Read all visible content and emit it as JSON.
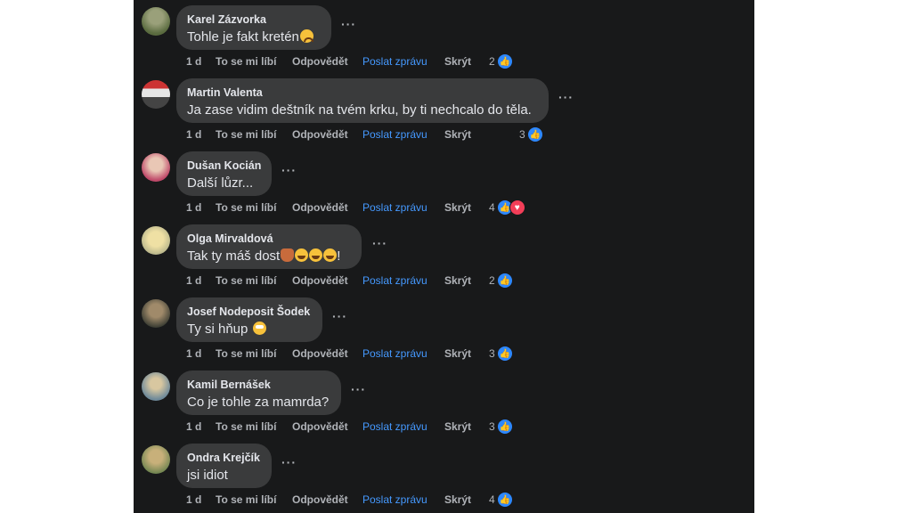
{
  "comments": [
    {
      "author": "Karel Zázvorka",
      "text": "Tohle je fakt kretén",
      "emoji": "sad",
      "time": "1 d",
      "like": "To se mi líbí",
      "reply": "Odpovědět",
      "message": "Poslat zprávu",
      "hide": "Skrýt",
      "reactions": "2",
      "love": false
    },
    {
      "author": "Martin Valenta",
      "text": "Ja zase vidim deštník na tvém krku, by ti nechcalo do těla.",
      "emoji": "",
      "time": "1 d",
      "like": "To se mi líbí",
      "reply": "Odpovědět",
      "message": "Poslat zprávu",
      "hide": "Skrýt",
      "reactions": "3",
      "love": false
    },
    {
      "author": "Dušan Kocián",
      "text": "Další lůzr...",
      "emoji": "",
      "time": "1 d",
      "like": "To se mi líbí",
      "reply": "Odpovědět",
      "message": "Poslat zprávu",
      "hide": "Skrýt",
      "reactions": "4",
      "love": true
    },
    {
      "author": "Olga Mirvaldová",
      "text": "Tak ty máš dost",
      "text_end": "!",
      "emoji": "person,laugh,laugh,laugh",
      "time": "1 d",
      "like": "To se mi líbí",
      "reply": "Odpovědět",
      "message": "Poslat zprávu",
      "hide": "Skrýt",
      "reactions": "2",
      "love": false
    },
    {
      "author": "Josef Nodeposit Šodek",
      "text": "Ty si hňup ",
      "emoji": "roll",
      "time": "1 d",
      "like": "To se mi líbí",
      "reply": "Odpovědět",
      "message": "Poslat zprávu",
      "hide": "Skrýt",
      "reactions": "3",
      "love": false
    },
    {
      "author": "Kamil Bernášek",
      "text": "Co je tohle za mamrda?",
      "emoji": "",
      "time": "1 d",
      "like": "To se mi líbí",
      "reply": "Odpovědět",
      "message": "Poslat zprávu",
      "hide": "Skrýt",
      "reactions": "3",
      "love": false
    },
    {
      "author": "Ondra Krejčík",
      "text": "jsi idiot",
      "emoji": "",
      "time": "1 d",
      "like": "To se mi líbí",
      "reply": "Odpovědět",
      "message": "Poslat zprávu",
      "hide": "Skrýt",
      "reactions": "4",
      "love": false
    }
  ],
  "more_label": "···",
  "colors": {
    "panel": "#18191a",
    "bubble": "#3a3b3c",
    "text": "#e4e6eb",
    "muted": "#b0b3b8",
    "link": "#4599ff",
    "like": "#2d88ff",
    "love": "#f33e58"
  },
  "icons": {
    "like": "like-icon",
    "love": "love-icon",
    "more": "more-options-icon"
  }
}
